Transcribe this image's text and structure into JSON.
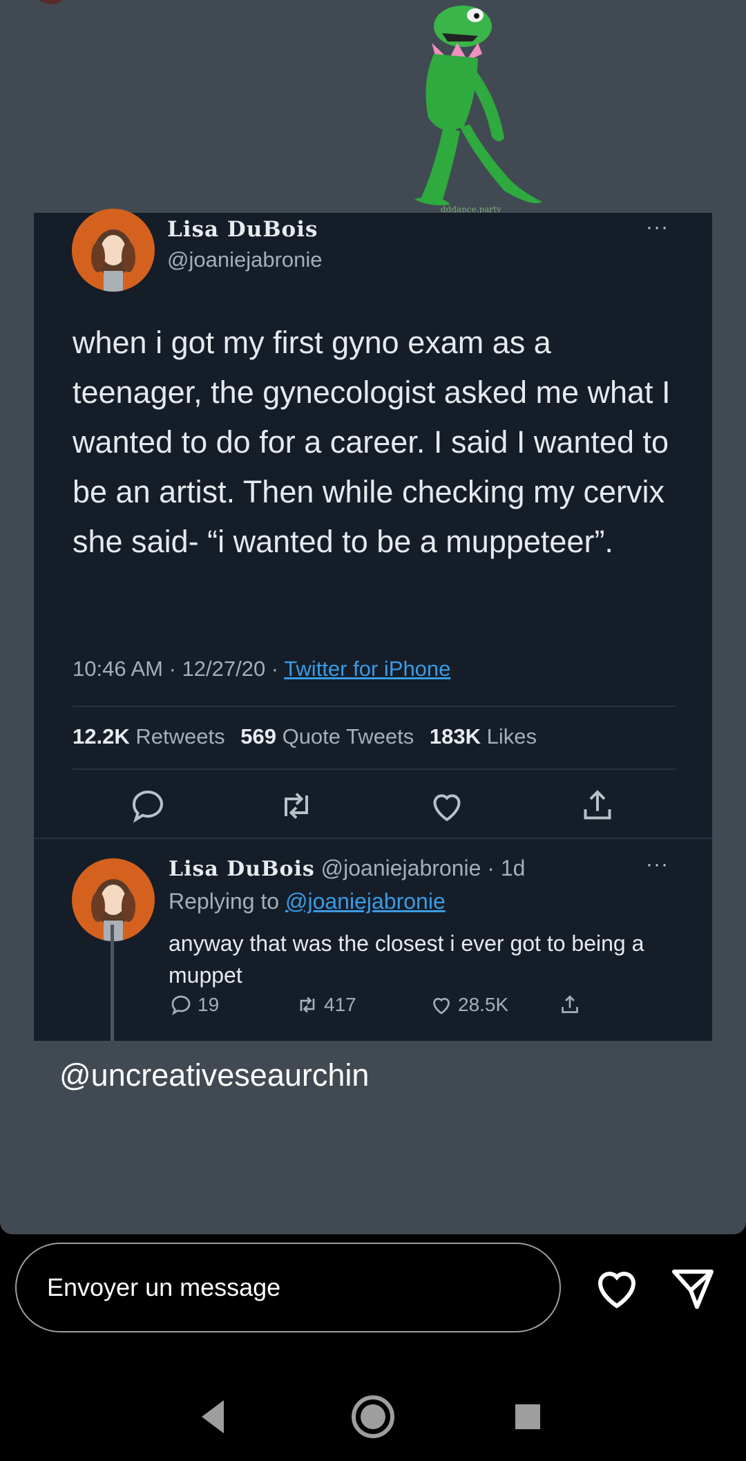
{
  "sticker": {
    "credit": "dddance.party"
  },
  "tweet": {
    "author_name": "Lisa DuBois",
    "author_handle": "@joaniejabronie",
    "text": "when i got my first gyno exam as a teenager, the gynecologist asked me what I wanted to do for a career. I said I wanted to be an artist. Then while checking my cervix she said- “i wanted to be a muppeteer”.",
    "time": "10:46 AM · 12/27/20 · ",
    "source": "Twitter for iPhone",
    "stats": {
      "retweets_count": "12.2K",
      "retweets_label": "Retweets",
      "quotes_count": "569",
      "quotes_label": "Quote Tweets",
      "likes_count": "183K",
      "likes_label": "Likes"
    },
    "more": "···"
  },
  "reply": {
    "author_name": "Lisa DuBois",
    "author_handle": "@joaniejabronie · 1d",
    "replying_prefix": "Replying to ",
    "replying_handle": "@joaniejabronie",
    "text": "anyway that was the closest i ever got to being a muppet",
    "replies": "19",
    "retweets": "417",
    "likes": "28.5K",
    "more": "···"
  },
  "story": {
    "mention": "@uncreativeseaurchin"
  },
  "composer": {
    "placeholder": "Envoyer un message"
  },
  "icons": {
    "reply": "speech-bubble-icon",
    "retweet": "retweet-icon",
    "like": "heart-icon",
    "share": "share-icon",
    "send": "paper-plane-icon",
    "nav_back": "triangle-back-icon",
    "nav_home": "circle-home-icon",
    "nav_recents": "square-recents-icon"
  },
  "colors": {
    "tweet_bg": "#151d28",
    "story_bg": "#414a52",
    "link": "#3a9be5",
    "avatar": "#d4621e"
  }
}
